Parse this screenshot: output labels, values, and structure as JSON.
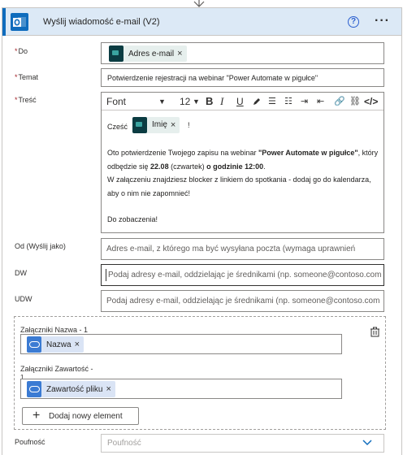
{
  "card": {
    "title": "Wyślij wiadomość e-mail (V2)",
    "help_symbol": "?",
    "more_symbol": "···"
  },
  "fields": {
    "to": {
      "label": "Do",
      "required_mark": "*",
      "token_label": "Adres e-mail",
      "token_remove": "×"
    },
    "subject": {
      "label": "Temat",
      "required_mark": "*",
      "value": "Potwierdzenie rejestracji na webinar \"Power Automate w pigułce\""
    },
    "body": {
      "label": "Treść",
      "required_mark": "*",
      "toolbar": {
        "font": "Font",
        "font_size": "12",
        "bold": "B",
        "italic": "I",
        "underline": "U",
        "bullets": "☰",
        "numbered": "☷",
        "indent": "⇥",
        "outdent": "⇤",
        "link": "🔗",
        "unlink": "⛓",
        "code": "</>"
      },
      "greeting": "Cześć",
      "greeting_token": "Imię",
      "greeting_token_remove": "×",
      "greeting_end": "!",
      "para1_a": "Oto potwierdzenie Twojego zapisu na webinar ",
      "para1_b_bold": "\"Power Automate w pigułce\"",
      "para1_c": ", który odbędzie się ",
      "para1_d_bold": "22.08",
      "para1_e_bold": " (czwartek)",
      "para1_f_bold": " o godzinie 12:00",
      "para1_g": ".",
      "para2": "W załączeniu znajdziesz blocker z linkiem do spotkania - dodaj go do kalendarza, aby o nim nie zapomnieć!",
      "closing": "Do zobaczenia!"
    },
    "from": {
      "label": "Od (Wyślij jako)",
      "placeholder": "Adres e-mail, z którego ma być wysyłana poczta (wymaga uprawnień"
    },
    "cc": {
      "label": "DW",
      "placeholder": "Podaj adresy e-mail, oddzielając je średnikami (np. someone@contoso.com)"
    },
    "bcc": {
      "label": "UDW",
      "placeholder": "Podaj adresy e-mail, oddzielając je średnikami (np. someone@contoso.com)"
    },
    "attachments": {
      "name_label": "Załączniki Nazwa - 1",
      "name_token": "Nazwa",
      "name_token_remove": "×",
      "content_label_1": "Załączniki Zawartość -",
      "content_label_2": "1",
      "content_token": "Zawartość pliku",
      "content_token_remove": "×",
      "add_button": "Dodaj nowy element",
      "add_symbol": "+"
    },
    "importance": {
      "label": "Poufność",
      "placeholder": "Poufność"
    }
  },
  "colors": {
    "header_bg": "#dce9f6",
    "accent": "#0f6cbd",
    "required": "#a4262c",
    "dynamic_token_bg": "#e6efed",
    "cloud_token_bg": "#dae4f5"
  }
}
